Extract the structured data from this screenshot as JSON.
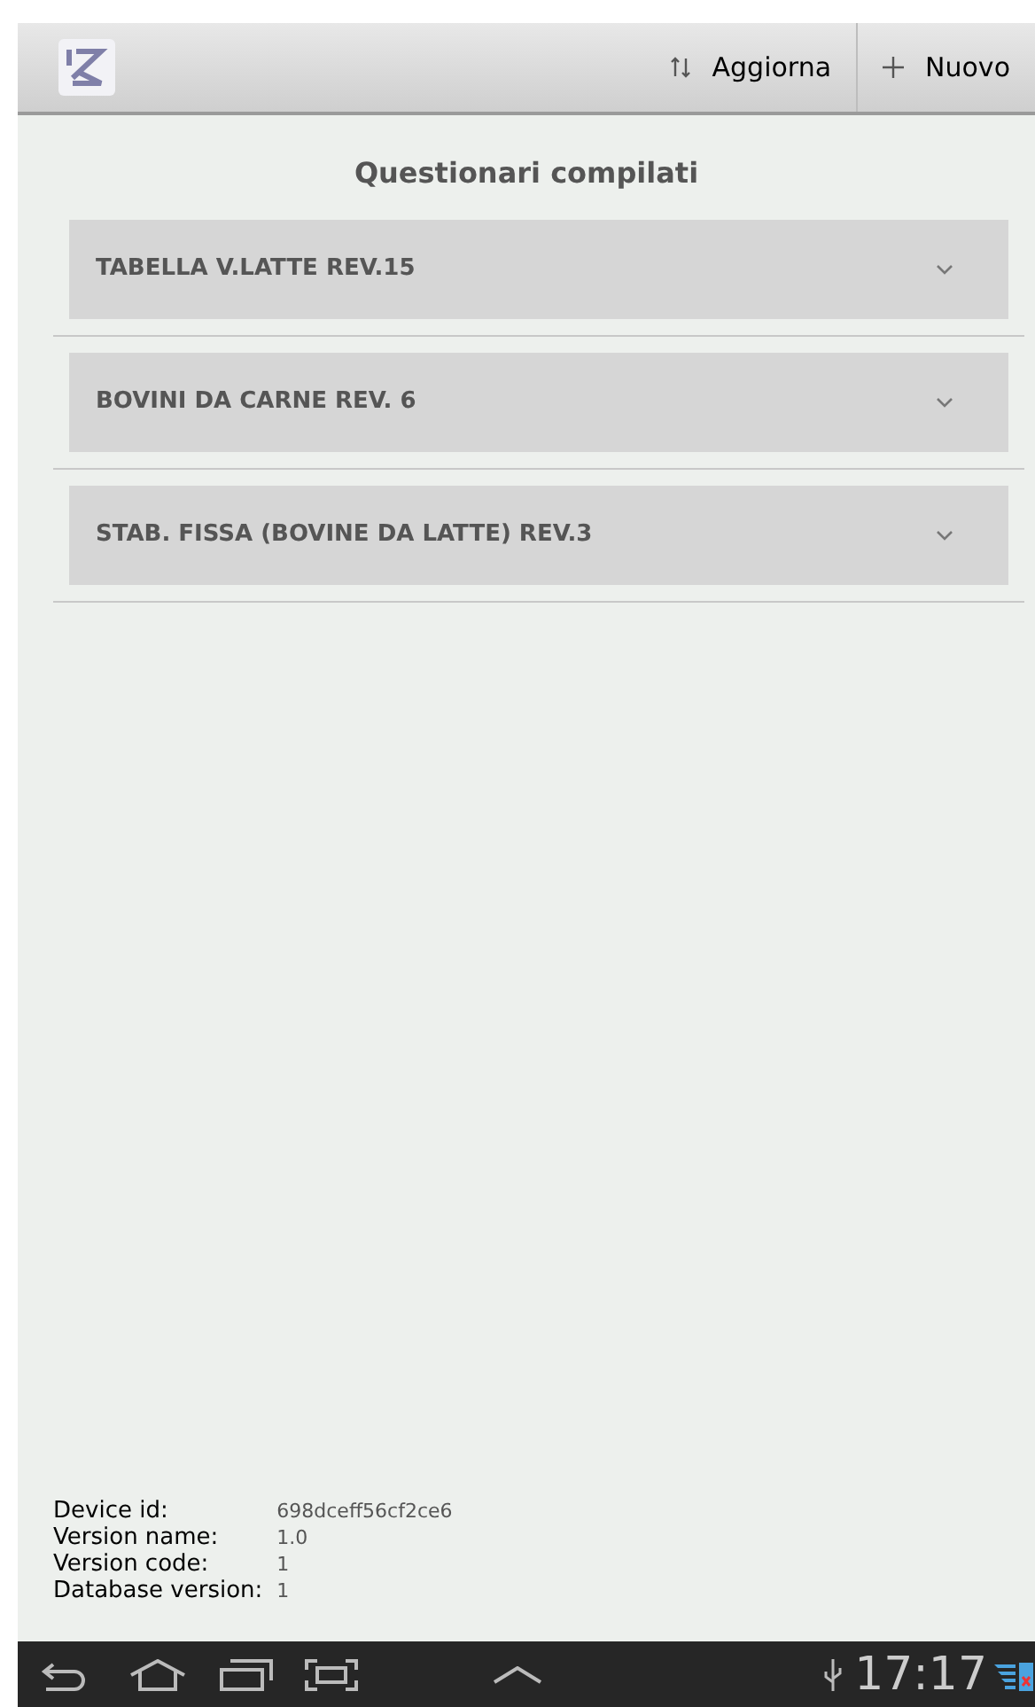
{
  "action_bar": {
    "actions": [
      {
        "kind": "refresh",
        "label": "Aggiorna"
      },
      {
        "kind": "add",
        "label": "Nuovo"
      }
    ]
  },
  "title": "Questionari compilati",
  "questionnaires": [
    {
      "label": "TABELLA V.LATTE REV.15"
    },
    {
      "label": "BOVINI DA CARNE REV. 6"
    },
    {
      "label": "STAB. FISSA (BOVINE DA LATTE) REV.3"
    }
  ],
  "info": [
    {
      "label": "Device id:",
      "value": "698dceff56cf2ce6"
    },
    {
      "label": "Version name:",
      "value": "1.0"
    },
    {
      "label": "Version code:",
      "value": "1"
    },
    {
      "label": "Database version:",
      "value": "1"
    }
  ],
  "status_bar": {
    "time": "17:17"
  }
}
